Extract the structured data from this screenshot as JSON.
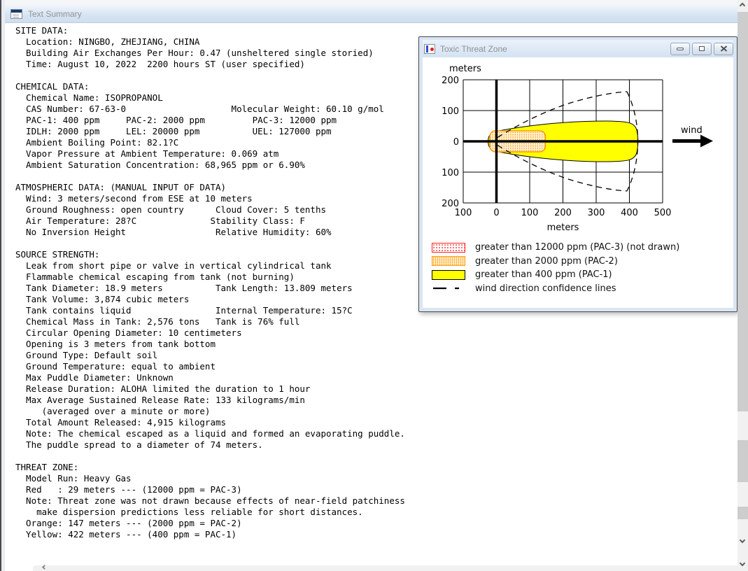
{
  "main_window": {
    "title": "Text Summary"
  },
  "text_summary": {
    "lines": [
      "SITE DATA:",
      "  Location: NINGBO, ZHEJIANG, CHINA",
      "  Building Air Exchanges Per Hour: 0.47 (unsheltered single storied)",
      "  Time: August 10, 2022  2200 hours ST (user specified)",
      "",
      "CHEMICAL DATA:",
      "  Chemical Name: ISOPROPANOL",
      "  CAS Number: 67-63-0                    Molecular Weight: 60.10 g/mol",
      "  PAC-1: 400 ppm     PAC-2: 2000 ppm         PAC-3: 12000 ppm",
      "  IDLH: 2000 ppm     LEL: 20000 ppm          UEL: 127000 ppm",
      "  Ambient Boiling Point: 82.1?C",
      "  Vapor Pressure at Ambient Temperature: 0.069 atm",
      "  Ambient Saturation Concentration: 68,965 ppm or 6.90%",
      "",
      "ATMOSPHERIC DATA: (MANUAL INPUT OF DATA)",
      "  Wind: 3 meters/second from ESE at 10 meters",
      "  Ground Roughness: open country      Cloud Cover: 5 tenths",
      "  Air Temperature: 28?C              Stability Class: F",
      "  No Inversion Height                 Relative Humidity: 60%",
      "",
      "SOURCE STRENGTH:",
      "  Leak from short pipe or valve in vertical cylindrical tank",
      "  Flammable chemical escaping from tank (not burning)",
      "  Tank Diameter: 18.9 meters          Tank Length: 13.809 meters",
      "  Tank Volume: 3,874 cubic meters",
      "  Tank contains liquid                Internal Temperature: 15?C",
      "  Chemical Mass in Tank: 2,576 tons   Tank is 76% full",
      "  Circular Opening Diameter: 10 centimeters",
      "  Opening is 3 meters from tank bottom",
      "  Ground Type: Default soil",
      "  Ground Temperature: equal to ambient",
      "  Max Puddle Diameter: Unknown",
      "  Release Duration: ALOHA limited the duration to 1 hour",
      "  Max Average Sustained Release Rate: 133 kilograms/min",
      "     (averaged over a minute or more)",
      "  Total Amount Released: 4,915 kilograms",
      "  Note: The chemical escaped as a liquid and formed an evaporating puddle.",
      "  The puddle spread to a diameter of 74 meters.",
      "",
      "THREAT ZONE:",
      "  Model Run: Heavy Gas",
      "  Red   : 29 meters --- (12000 ppm = PAC-3)",
      "  Note: Threat zone was not drawn because effects of near-field patchiness",
      "    make dispersion predictions less reliable for short distances.",
      "  Orange: 147 meters --- (2000 ppm = PAC-2)",
      "  Yellow: 422 meters --- (400 ppm = PAC-1)"
    ]
  },
  "toxic_window": {
    "title": "Toxic Threat Zone"
  },
  "chart_data": {
    "type": "area",
    "title": "Toxic Threat Zone",
    "xlabel": "meters",
    "ylabel": "meters",
    "xlim_m": [
      -100,
      500
    ],
    "ylim_m": [
      -200,
      200
    ],
    "x_ticks": [
      "100",
      "0",
      "100",
      "200",
      "300",
      "400",
      "500"
    ],
    "y_ticks": [
      "200",
      "100",
      "0",
      "100",
      "200"
    ],
    "grid": true,
    "wind_label": "wind",
    "zones": [
      {
        "level": "PAC-3",
        "threshold_ppm": 12000,
        "color_hex": "#ff0000",
        "downwind_m": 29,
        "drawn": false
      },
      {
        "level": "PAC-2",
        "threshold_ppm": 2000,
        "color_hex": "#ff9900",
        "downwind_m": 147,
        "upwind_m": 20,
        "max_half_width_m": 34,
        "drawn": true
      },
      {
        "level": "PAC-1",
        "threshold_ppm": 400,
        "color_hex": "#ffff00",
        "downwind_m": 422,
        "upwind_m": 25,
        "max_half_width_m": 66,
        "drawn": true
      },
      {
        "level": "wind-direction-confidence",
        "style": "dashed",
        "downwind_m": 430,
        "max_half_width_m": 165,
        "drawn": true
      }
    ],
    "legend": [
      {
        "swatch": "red-dotted",
        "label": "greater than 12000 ppm (PAC-3) (not drawn)"
      },
      {
        "swatch": "orange-dotted",
        "label": "greater than 2000 ppm (PAC-2)"
      },
      {
        "swatch": "yellow-solid",
        "label": "greater than 400 ppm (PAC-1)"
      },
      {
        "swatch": "dashed-line",
        "label": "wind direction confidence lines"
      }
    ]
  }
}
